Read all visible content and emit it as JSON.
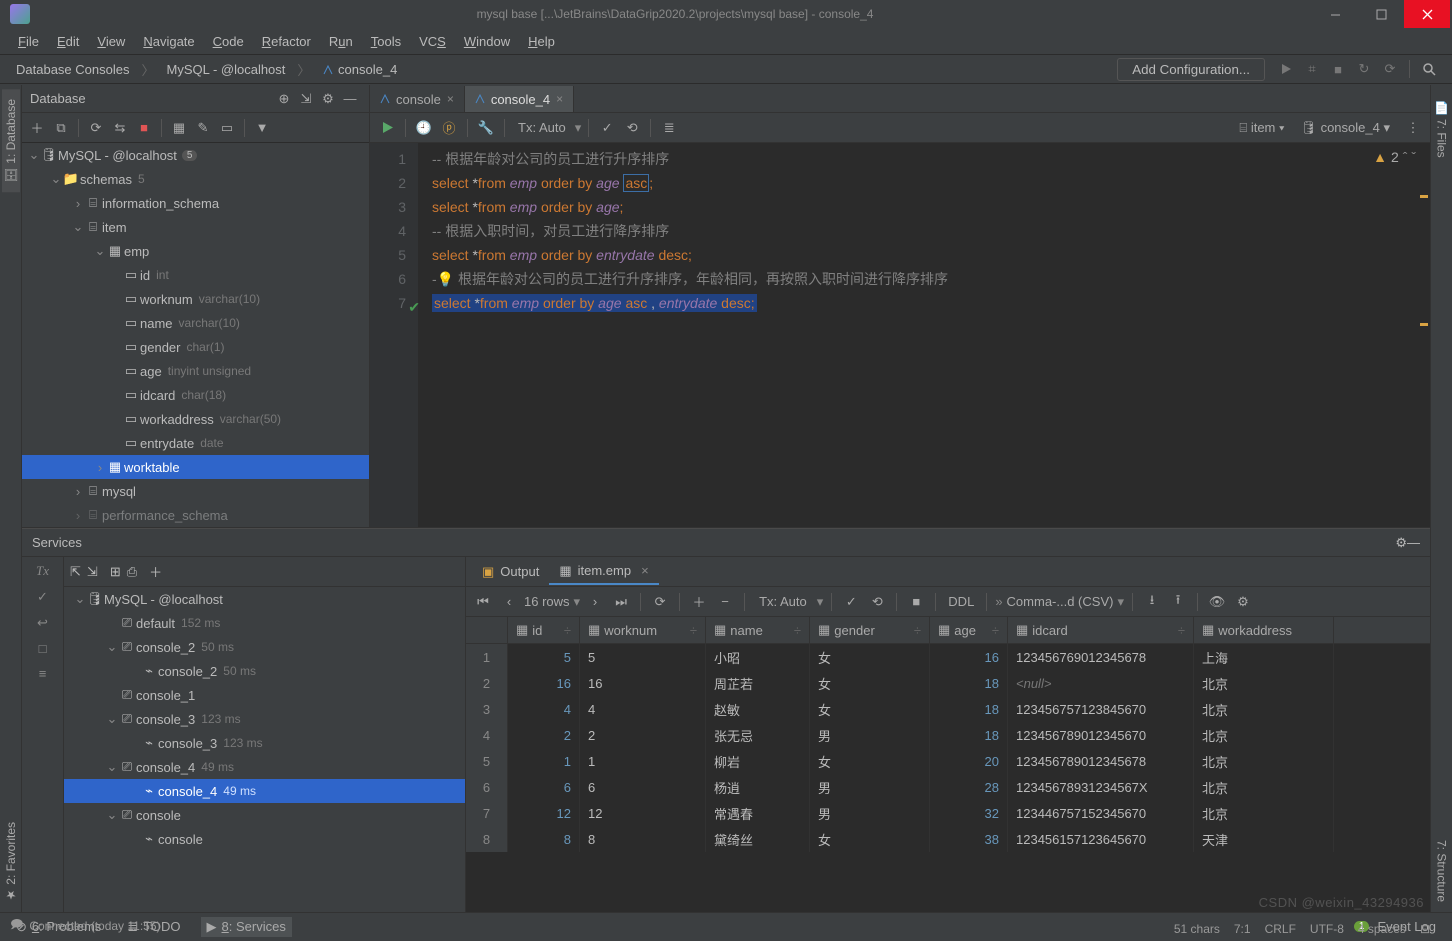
{
  "titlebar": {
    "project": "mysql base",
    "path_hint": "[...\\JetBrains\\DataGrip2020.2\\projects\\mysql base] - console_4"
  },
  "menubar": [
    "File",
    "Edit",
    "View",
    "Navigate",
    "Code",
    "Refactor",
    "Run",
    "Tools",
    "VCS",
    "Window",
    "Help"
  ],
  "breadcrumbs": [
    "Database Consoles",
    "MySQL - @localhost",
    "console_4"
  ],
  "add_configuration": "Add Configuration...",
  "db_panel": {
    "title": "Database",
    "root": "MySQL - @localhost",
    "root_count": "5",
    "schemas_label": "schemas",
    "schemas_count": "5",
    "nodes": {
      "info_schema": "information_schema",
      "item": "item",
      "emp": "emp",
      "mysql": "mysql",
      "worktable": "worktable",
      "perf": "performance_schema"
    },
    "columns": [
      {
        "name": "id",
        "type": "int"
      },
      {
        "name": "worknum",
        "type": "varchar(10)"
      },
      {
        "name": "name",
        "type": "varchar(10)"
      },
      {
        "name": "gender",
        "type": "char(1)"
      },
      {
        "name": "age",
        "type": "tinyint unsigned"
      },
      {
        "name": "idcard",
        "type": "char(18)"
      },
      {
        "name": "workaddress",
        "type": "varchar(50)"
      },
      {
        "name": "entrydate",
        "type": "date"
      }
    ]
  },
  "editor": {
    "tabs": [
      {
        "label": "console",
        "active": false
      },
      {
        "label": "console_4",
        "active": true
      }
    ],
    "tx_mode": "Tx: Auto",
    "schema_selector": "item",
    "session_selector": "console_4",
    "warnings": "2",
    "lines": [
      {
        "type": "comment",
        "text": "-- 根据年龄对公司的员工进行升序排序"
      },
      {
        "type": "sql",
        "tokens": [
          "select",
          " *",
          "from",
          " emp ",
          "order by",
          " age ",
          "asc",
          ";"
        ],
        "asc_boxed": true
      },
      {
        "type": "sql",
        "tokens": [
          "select",
          " *",
          "from",
          " emp ",
          "order by",
          " age",
          ";"
        ]
      },
      {
        "type": "comment",
        "text": "-- 根据入职时间，对员工进行降序排序"
      },
      {
        "type": "sql",
        "tokens": [
          "select",
          " *",
          "from",
          " emp ",
          "order by",
          " entrydate ",
          "desc",
          ";"
        ]
      },
      {
        "type": "bulb_comment",
        "text": "根据年龄对公司的员工进行升序排序，年龄相同，再按照入职时间进行降序排序"
      },
      {
        "type": "sql_selected",
        "tokens": [
          "select",
          " *",
          "from",
          " emp ",
          "order by",
          " age ",
          "asc",
          " , ",
          "entrydate ",
          "desc",
          ";"
        ]
      }
    ]
  },
  "services": {
    "title": "Services",
    "connection": "MySQL - @localhost",
    "items": [
      {
        "label": "default",
        "meta": "152 ms",
        "indent": 1,
        "icon": "group"
      },
      {
        "label": "console_2",
        "meta": "50 ms",
        "indent": 1,
        "icon": "group",
        "exp": true
      },
      {
        "label": "console_2",
        "meta": "50 ms",
        "indent": 2,
        "icon": "console"
      },
      {
        "label": "console_1",
        "meta": "",
        "indent": 1,
        "icon": "group"
      },
      {
        "label": "console_3",
        "meta": "123 ms",
        "indent": 1,
        "icon": "group",
        "exp": true
      },
      {
        "label": "console_3",
        "meta": "123 ms",
        "indent": 2,
        "icon": "console"
      },
      {
        "label": "console_4",
        "meta": "49 ms",
        "indent": 1,
        "icon": "group",
        "exp": true
      },
      {
        "label": "console_4",
        "meta": "49 ms",
        "indent": 2,
        "icon": "console",
        "sel": true
      },
      {
        "label": "console",
        "meta": "",
        "indent": 1,
        "icon": "group",
        "exp": true
      },
      {
        "label": "console",
        "meta": "",
        "indent": 2,
        "icon": "console"
      }
    ]
  },
  "results": {
    "output_label": "Output",
    "tab_label": "item.emp",
    "row_count": "16 rows",
    "tx_mode": "Tx: Auto",
    "ddl": "DDL",
    "export": "Comma-...d (CSV)",
    "columns": [
      "id",
      "worknum",
      "name",
      "gender",
      "age",
      "idcard",
      "workaddress"
    ],
    "rows": [
      {
        "n": 1,
        "id": 5,
        "worknum": "5",
        "name": "小昭",
        "gender": "女",
        "age": 16,
        "idcard": "123456769012345678",
        "addr": "上海"
      },
      {
        "n": 2,
        "id": 16,
        "worknum": "16",
        "name": "周芷若",
        "gender": "女",
        "age": 18,
        "idcard": null,
        "addr": "北京"
      },
      {
        "n": 3,
        "id": 4,
        "worknum": "4",
        "name": "赵敏",
        "gender": "女",
        "age": 18,
        "idcard": "123456757123845670",
        "addr": "北京"
      },
      {
        "n": 4,
        "id": 2,
        "worknum": "2",
        "name": "张无忌",
        "gender": "男",
        "age": 18,
        "idcard": "123456789012345670",
        "addr": "北京"
      },
      {
        "n": 5,
        "id": 1,
        "worknum": "1",
        "name": "柳岩",
        "gender": "女",
        "age": 20,
        "idcard": "123456789012345678",
        "addr": "北京"
      },
      {
        "n": 6,
        "id": 6,
        "worknum": "6",
        "name": "杨逍",
        "gender": "男",
        "age": 28,
        "idcard": "12345678931234567X",
        "addr": "北京"
      },
      {
        "n": 7,
        "id": 12,
        "worknum": "12",
        "name": "常遇春",
        "gender": "男",
        "age": 32,
        "idcard": "123446757152345670",
        "addr": "北京"
      },
      {
        "n": 8,
        "id": 8,
        "worknum": "8",
        "name": "黛绮丝",
        "gender": "女",
        "age": 38,
        "idcard": "123456157123645670",
        "addr": "天津"
      }
    ]
  },
  "bottom_tabs": {
    "problems": "6: Problems",
    "todo": "TODO",
    "services": "8: Services",
    "eventlog": "Event Log",
    "eventcount": "1"
  },
  "statusbar": {
    "connected": "Connected (today 11:55)",
    "chars": "51 chars",
    "sep": "7:1",
    "crlf": "CRLF",
    "enc": "UTF-8",
    "indent": "4 spaces"
  },
  "watermark": "CSDN @weixin_43294936"
}
